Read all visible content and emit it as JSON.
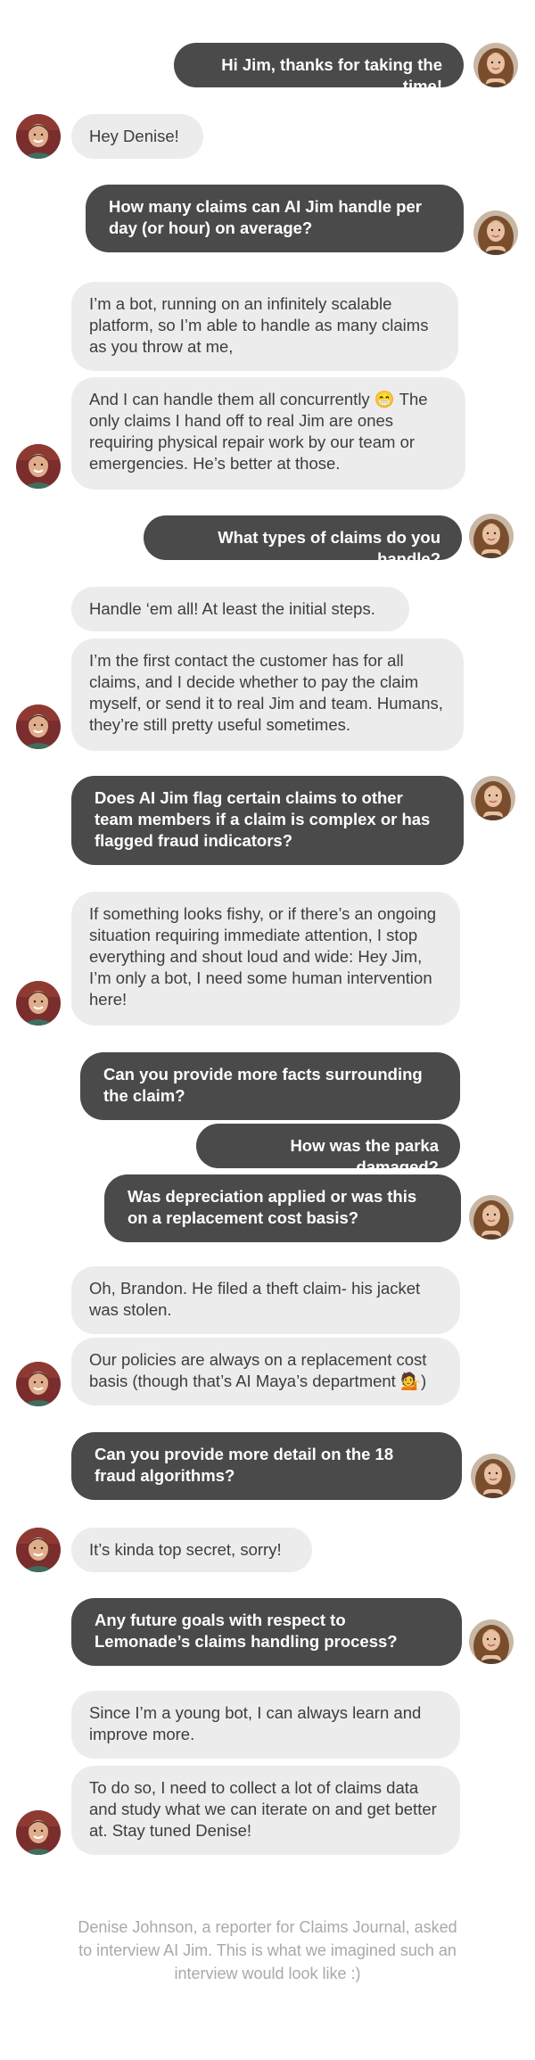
{
  "conversation": {
    "messages": [
      {
        "from": "denise",
        "text": "Hi Jim, thanks for taking the time!"
      },
      {
        "from": "jim",
        "text": "Hey Denise!"
      },
      {
        "from": "denise",
        "text": "How many claims can AI Jim handle per day (or hour) on average?"
      },
      {
        "from": "jim",
        "text": "I’m a bot, running on an infinitely scalable platform, so I’m able to handle as many claims as you throw at me,"
      },
      {
        "from": "jim",
        "text": "And I can handle them all concurrently 😁 The only claims I hand off to real Jim are ones requiring physical repair work by our team or emergencies. He’s better at those."
      },
      {
        "from": "denise",
        "text": "What types of claims do you handle?"
      },
      {
        "from": "jim",
        "text": "Handle ‘em all! At least the initial steps."
      },
      {
        "from": "jim",
        "text": "I’m the first contact the customer has for all claims, and I decide whether to pay the claim myself, or send it to real Jim and team. Humans, they’re still pretty useful sometimes."
      },
      {
        "from": "denise",
        "text": "Does AI Jim flag certain claims to other team members if a claim is complex or has flagged fraud indicators?"
      },
      {
        "from": "jim",
        "text": "If something looks fishy, or if there’s an ongoing situation requiring immediate attention, I stop everything and shout loud and wide: Hey Jim, I’m only a bot, I need some human intervention here!"
      },
      {
        "from": "denise",
        "text": "Can you provide more facts surrounding the claim?"
      },
      {
        "from": "denise",
        "text": "How was the parka damaged?"
      },
      {
        "from": "denise",
        "text": "Was depreciation applied or was this on a replacement cost basis?"
      },
      {
        "from": "jim",
        "text": "Oh, Brandon. He filed a theft claim- his jacket was stolen."
      },
      {
        "from": "jim",
        "text": "Our policies are always on a replacement cost basis (though that’s AI Maya’s department 💁)"
      },
      {
        "from": "denise",
        "text": "Can you provide more detail on the 18 fraud algorithms?"
      },
      {
        "from": "jim",
        "text": "It’s kinda top secret, sorry!"
      },
      {
        "from": "denise",
        "text": "Any future goals with respect to Lemonade’s claims handling process?"
      },
      {
        "from": "jim",
        "text": "Since I’m a young bot, I can always learn and improve more."
      },
      {
        "from": "jim",
        "text": "To do so, I need to collect a lot of claims data and study what we can iterate on and get better at. Stay tuned Denise!"
      }
    ],
    "caption": "Denise Johnson, a reporter for Claims Journal, asked to interview AI Jim. This is what we imagined such an interview would look like :)"
  },
  "colors": {
    "outgoing_bubble": "#4a4a4a",
    "incoming_bubble": "#ececec",
    "caption_text": "#a9a9a9"
  },
  "icons": {
    "denise_avatar": "woman-avatar-icon",
    "jim_avatar": "man-avatar-icon"
  }
}
